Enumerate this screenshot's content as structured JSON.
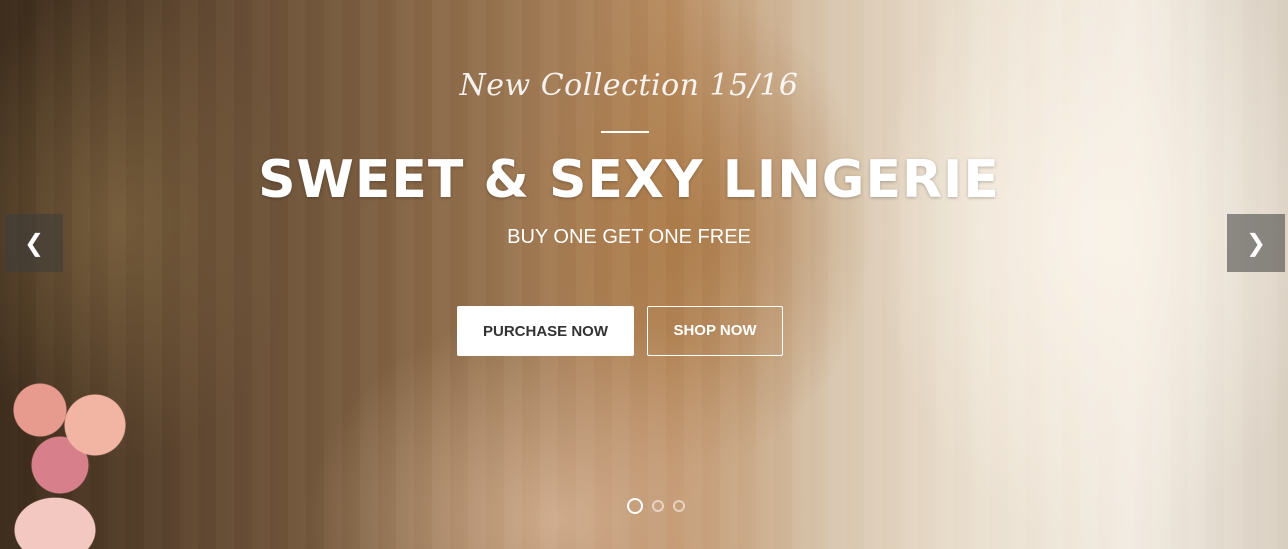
{
  "slider": {
    "subtitle": "New Collection 15/16",
    "title": "SWEET & SEXY LINGERIE",
    "tagline": "BUY ONE GET ONE FREE",
    "buttons": {
      "primary_label": "PURCHASE NOW",
      "secondary_label": "SHOP NOW"
    },
    "controls": {
      "prev_icon": "chevron-left-icon",
      "next_icon": "chevron-right-icon",
      "prev_glyph": "❮",
      "next_glyph": "❯"
    },
    "pagination": {
      "total": 3,
      "active_index": 0
    }
  },
  "colors": {
    "button_primary_bg": "#ffffff",
    "button_primary_text": "#333333",
    "caption_text": "#ffffff"
  }
}
